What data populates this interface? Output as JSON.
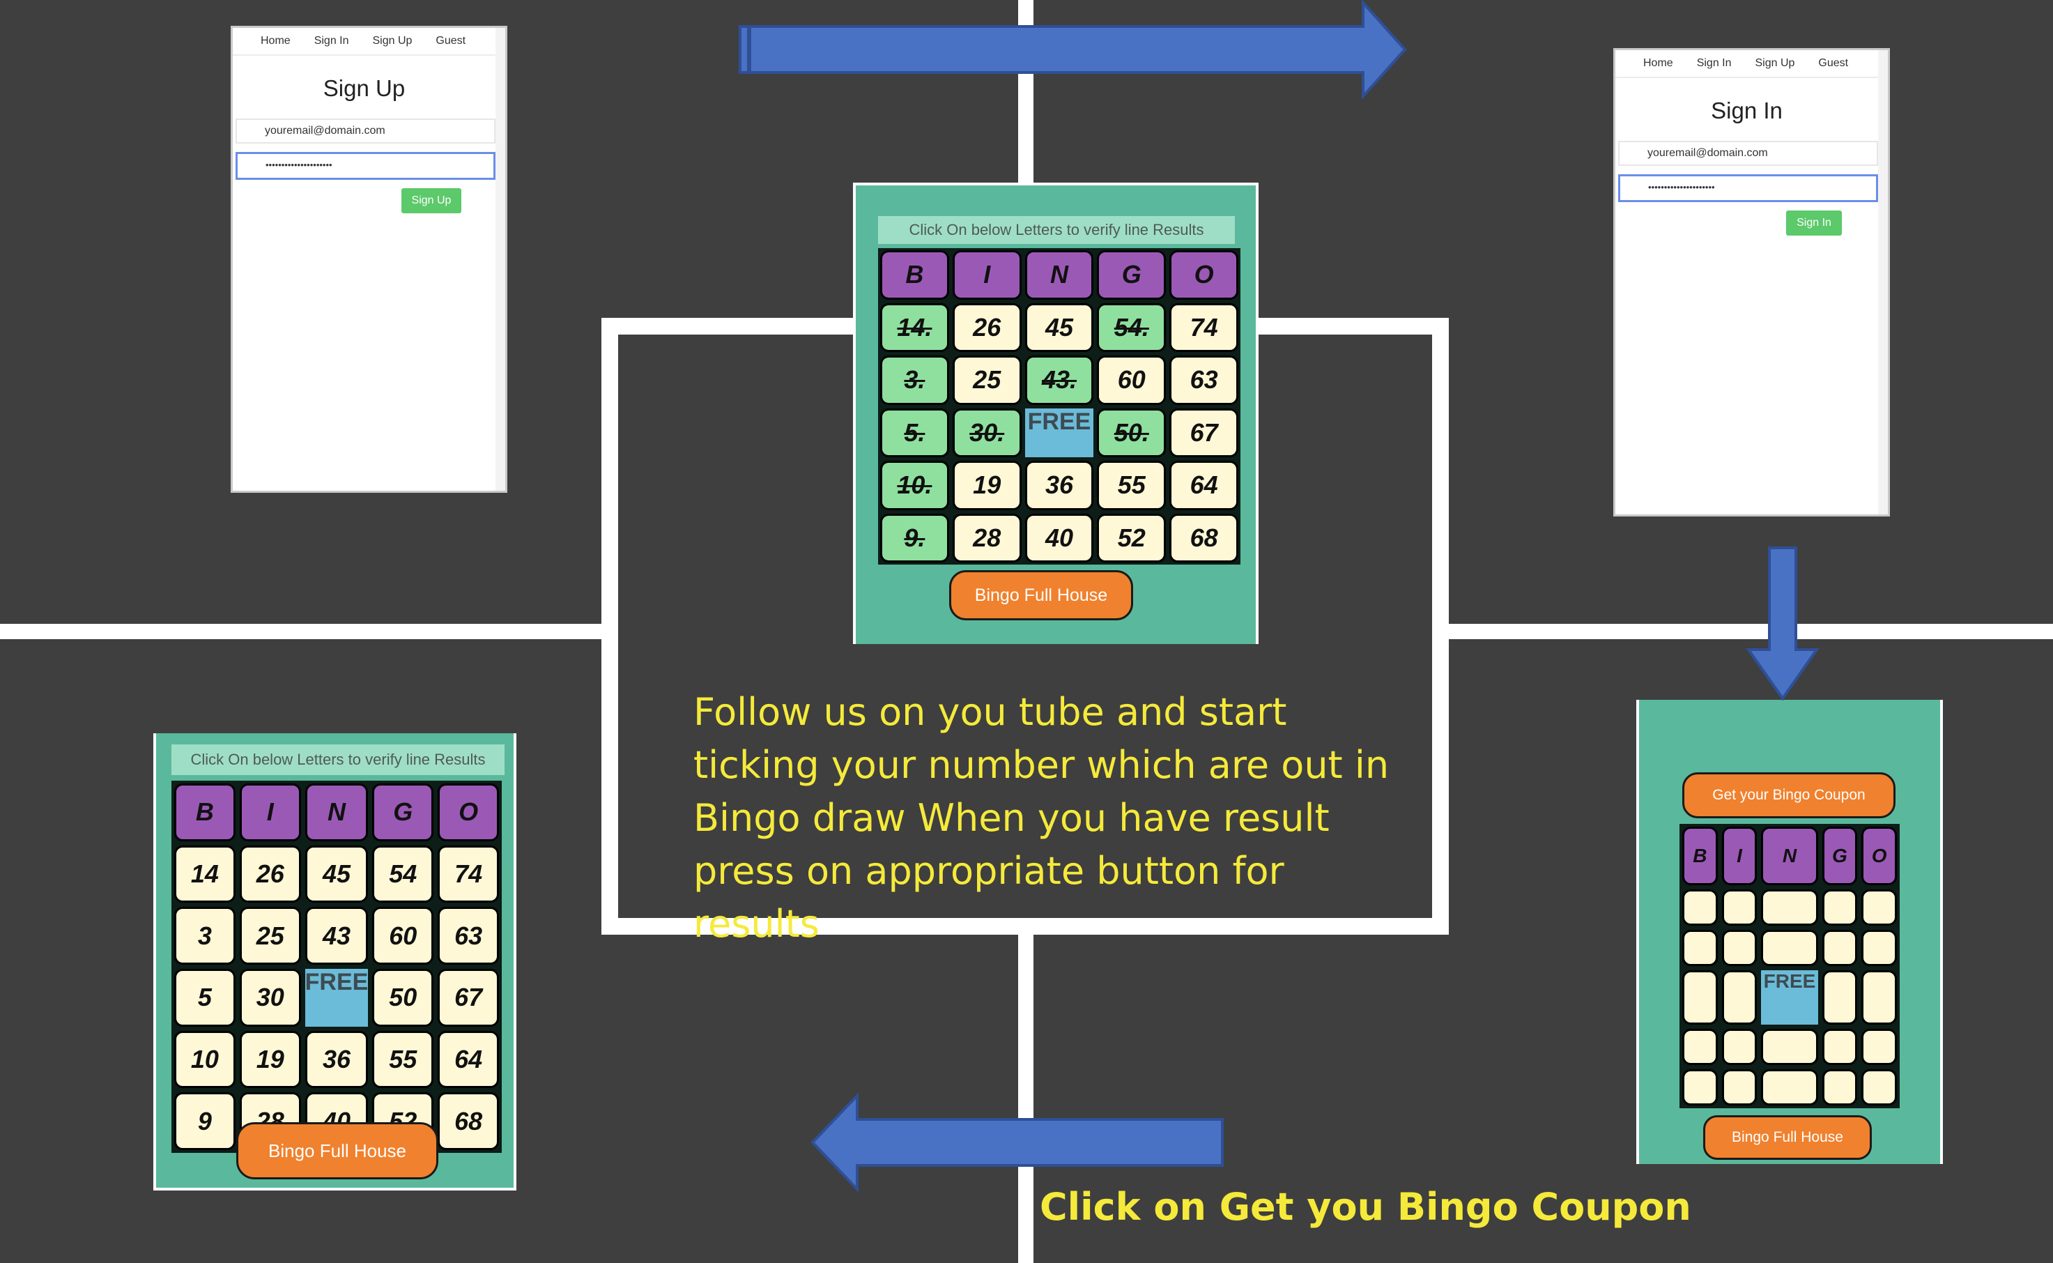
{
  "nav": {
    "home": "Home",
    "sign_in": "Sign In",
    "sign_up": "Sign Up",
    "guest": "Guest"
  },
  "signup": {
    "title": "Sign Up",
    "email_value": "youremail@domain.com",
    "password_value": "•••••••••••••••••••••",
    "button": "Sign Up"
  },
  "signin": {
    "title": "Sign In",
    "email_value": "youremail@domain.com",
    "password_value": "•••••••••••••••••••••",
    "button": "Sign In"
  },
  "card_center": {
    "header": "Click On below Letters to verify line Results",
    "letters": [
      "B",
      "I",
      "N",
      "G",
      "O"
    ],
    "rows": [
      [
        {
          "v": "14.",
          "t": true
        },
        {
          "v": "26"
        },
        {
          "v": "45"
        },
        {
          "v": "54.",
          "t": true
        },
        {
          "v": "74"
        }
      ],
      [
        {
          "v": "3.",
          "t": true
        },
        {
          "v": "25"
        },
        {
          "v": "43.",
          "t": true
        },
        {
          "v": "60"
        },
        {
          "v": "63"
        }
      ],
      [
        {
          "v": "5.",
          "t": true
        },
        {
          "v": "30.",
          "t": true
        },
        {
          "v": "FREE",
          "f": true
        },
        {
          "v": "50.",
          "t": true
        },
        {
          "v": "67"
        }
      ],
      [
        {
          "v": "10.",
          "t": true
        },
        {
          "v": "19"
        },
        {
          "v": "36"
        },
        {
          "v": "55"
        },
        {
          "v": "64"
        }
      ],
      [
        {
          "v": "9.",
          "t": true
        },
        {
          "v": "28"
        },
        {
          "v": "40"
        },
        {
          "v": "52"
        },
        {
          "v": "68"
        }
      ]
    ],
    "button": "Bingo Full House"
  },
  "card_left": {
    "header": "Click On below Letters to verify line Results",
    "letters": [
      "B",
      "I",
      "N",
      "G",
      "O"
    ],
    "rows": [
      [
        {
          "v": "14"
        },
        {
          "v": "26"
        },
        {
          "v": "45"
        },
        {
          "v": "54"
        },
        {
          "v": "74"
        }
      ],
      [
        {
          "v": "3"
        },
        {
          "v": "25"
        },
        {
          "v": "43"
        },
        {
          "v": "60"
        },
        {
          "v": "63"
        }
      ],
      [
        {
          "v": "5"
        },
        {
          "v": "30"
        },
        {
          "v": "FREE",
          "f": true
        },
        {
          "v": "50"
        },
        {
          "v": "67"
        }
      ],
      [
        {
          "v": "10"
        },
        {
          "v": "19"
        },
        {
          "v": "36"
        },
        {
          "v": "55"
        },
        {
          "v": "64"
        }
      ],
      [
        {
          "v": "9"
        },
        {
          "v": "28"
        },
        {
          "v": "40"
        },
        {
          "v": "52"
        },
        {
          "v": "68"
        }
      ]
    ],
    "button": "Bingo Full House"
  },
  "card_right": {
    "get_coupon": "Get your Bingo Coupon",
    "letters": [
      "B",
      "I",
      "N",
      "G",
      "O"
    ],
    "rows": [
      [
        {
          "v": ""
        },
        {
          "v": ""
        },
        {
          "v": ""
        },
        {
          "v": ""
        },
        {
          "v": ""
        }
      ],
      [
        {
          "v": ""
        },
        {
          "v": ""
        },
        {
          "v": ""
        },
        {
          "v": ""
        },
        {
          "v": ""
        }
      ],
      [
        {
          "v": ""
        },
        {
          "v": ""
        },
        {
          "v": "FREE",
          "f": true
        },
        {
          "v": ""
        },
        {
          "v": ""
        }
      ],
      [
        {
          "v": ""
        },
        {
          "v": ""
        },
        {
          "v": ""
        },
        {
          "v": ""
        },
        {
          "v": ""
        }
      ],
      [
        {
          "v": ""
        },
        {
          "v": ""
        },
        {
          "v": ""
        },
        {
          "v": ""
        },
        {
          "v": ""
        }
      ]
    ],
    "button": "Bingo Full House"
  },
  "instructions": "Follow us on you tube and start ticking your number which are out in Bingo draw When you have result press on appropriate button for results",
  "coupon_caption": "Click on Get you Bingo Coupon",
  "colors": {
    "background": "#3f3f3f",
    "arrow": "#4a72c4",
    "text_yellow": "#f5ea3a",
    "card_green": "#5ab99c",
    "button_orange": "#f0812e",
    "letter_purple": "#9b59b6"
  }
}
